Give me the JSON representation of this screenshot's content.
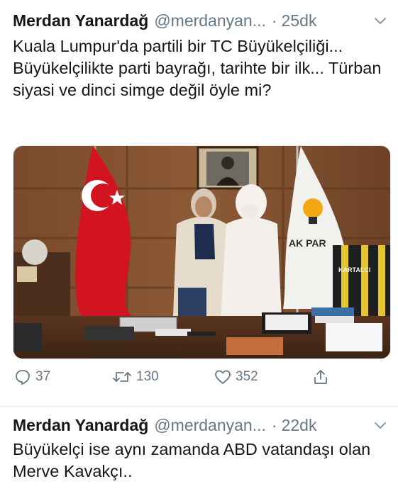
{
  "tweets": [
    {
      "author_name": "Merdan Yanardağ",
      "handle": "@merdanyan...",
      "separator": "·",
      "time": "25dk",
      "text": "Kuala Lumpur'da partili bir TC Büyükelçiliği... Büyükelçilikte parti bayrağı, tarihte bir ilk... Türban siyasi ve dinci simge değil öyle mi?",
      "photo": {
        "flag_party_text": "AK PAR",
        "jersey_text": "KARTALCI"
      },
      "replies": "37",
      "retweets": "130",
      "likes": "352"
    },
    {
      "author_name": "Merdan Yanardağ",
      "handle": "@merdanyan...",
      "separator": "·",
      "time": "22dk",
      "text": "Büyükelçi ise aynı zamanda ABD vatandaşı olan Merve Kavakçı.."
    }
  ],
  "colors": {
    "text": "#14171a",
    "secondary": "#657786",
    "divider": "#e6ecf0",
    "turkish_flag_red": "#d1141f"
  },
  "icons": [
    "reply-icon",
    "retweet-icon",
    "like-icon",
    "share-icon",
    "chevron-down-icon"
  ]
}
